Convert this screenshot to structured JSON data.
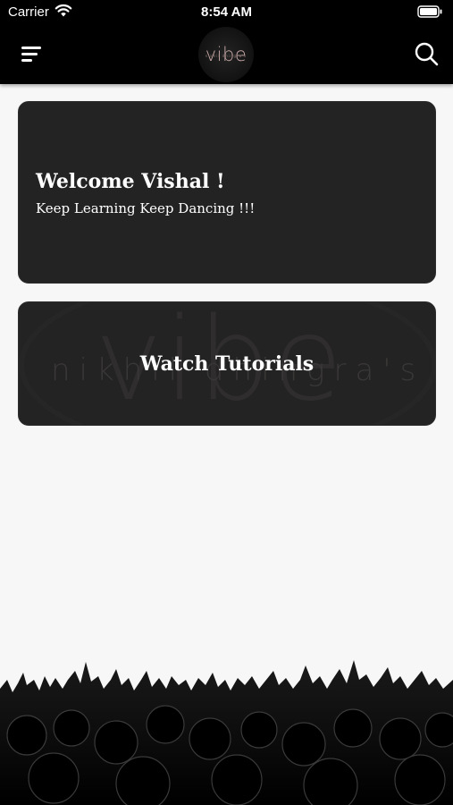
{
  "status_bar": {
    "carrier": "Carrier",
    "time": "8:54 AM"
  },
  "nav": {
    "logo_text": "vibe",
    "logo_subtext": "nikhil dhingra's",
    "menu_icon": "menu-icon",
    "search_icon": "search-icon"
  },
  "welcome_card": {
    "title": "Welcome Vishal !",
    "subtitle": "Keep Learning Keep Dancing !!!"
  },
  "tutorials_card": {
    "label": "Watch Tutorials",
    "watermark_big": "vibe",
    "watermark_small": "nikhil dhingra's"
  },
  "colors": {
    "nav_background": "#000000",
    "card_background": "#232323",
    "page_background": "#f7f7f7",
    "logo_accent": "#c9aaa7"
  }
}
